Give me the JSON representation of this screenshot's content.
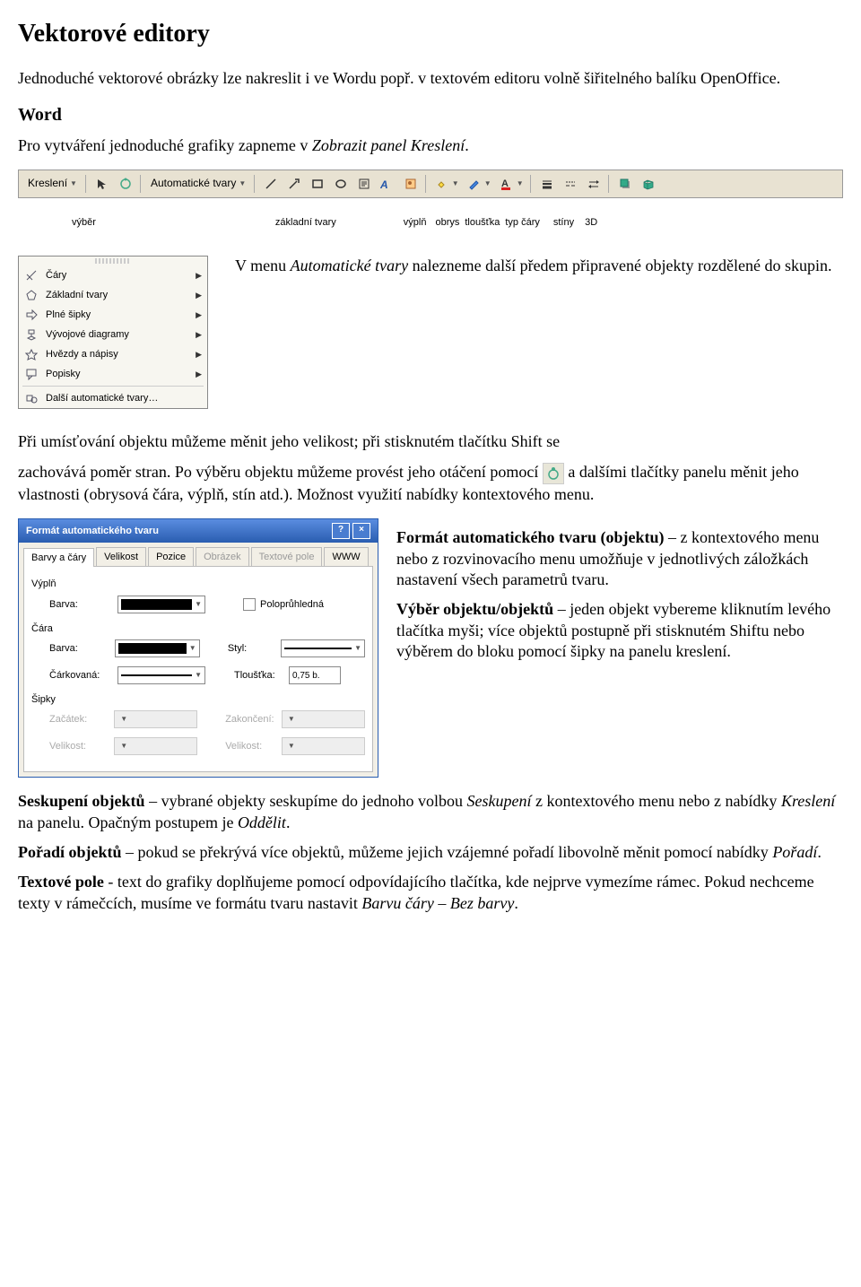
{
  "title": "Vektorové editory",
  "intro": "Jednoduché vektorové obrázky lze nakreslit i ve Wordu popř. v textovém editoru volně šiřitelného balíku OpenOffice.",
  "word_heading": "Word",
  "word_text_pre": "Pro vytváření jednoduché grafiky zapneme v ",
  "word_text_italic": "Zobrazit panel Kreslení",
  "toolbar": {
    "draw": "Kreslení",
    "autoshapes": "Automatické tvary"
  },
  "toolbar_labels": {
    "vyber": "výběr",
    "zakladni_tvary": "základní tvary",
    "vypln": "výplň",
    "obrys": "obrys",
    "tloustka": "tloušťka",
    "typ_cary": "typ čáry",
    "stiny": "stíny",
    "treed": "3D"
  },
  "autoshapes_menu": {
    "items": [
      "Čáry",
      "Základní tvary",
      "Plné šipky",
      "Vývojové diagramy",
      "Hvězdy a nápisy",
      "Popisky"
    ],
    "more": "Další automatické tvary…"
  },
  "autoshapes_text_pre": "V menu ",
  "autoshapes_text_italic": "Automatické tvary",
  "autoshapes_text_post": " nalezneme další předem připravené objekty rozdělené do skupin.",
  "positioning_text": "Při umísťování objektu můžeme měnit jeho velikost; při stisknutém tlačítku Shift se",
  "positioning_text2": "zachovává poměr stran. Po výběru objektu můžeme provést jeho otáčení pomocí ",
  "positioning_text3": " a dalšími tlačítky panelu měnit jeho vlastnosti (obrysová čára, výplň, stín atd.). Možnost využití nabídky kontextového menu.",
  "dialog": {
    "title": "Formát automatického tvaru",
    "tabs": [
      "Barvy a čáry",
      "Velikost",
      "Pozice",
      "Obrázek",
      "Textové pole",
      "WWW"
    ],
    "vypln": "Výplň",
    "barva": "Barva:",
    "polopruhledna": "Poloprůhledná",
    "cara": "Čára",
    "styl": "Styl:",
    "carkovana": "Čárkovaná:",
    "tloustka": "Tloušťka:",
    "tloustka_val": "0,75 b.",
    "sipky": "Šipky",
    "zacatek": "Začátek:",
    "zakonceni": "Zakončení:",
    "velikost": "Velikost:"
  },
  "format_paragraph": {
    "bold": "Formát automatického tvaru (objektu)",
    "rest": " – z kontextového menu nebo z rozvinovacího menu umožňuje v jednotlivých záložkách nastavení všech parametrů tvaru."
  },
  "selection_paragraph": {
    "bold": "Výběr objektu/objektů",
    "rest": " – jeden objekt vybereme kliknutím levého tlačítka myši; více objektů postupně při stisknutém Shiftu nebo výběrem do bloku pomocí šipky na panelu kreslení."
  },
  "grouping": {
    "bold": "Seskupení objektů",
    "t1": " – vybrané objekty seskupíme do jednoho volbou ",
    "i1": "Seskupení",
    "t2": " z kontextového menu nebo z nabídky ",
    "i2": "Kreslení",
    "t3": " na panelu. Opačným postupem je ",
    "i3": "Oddělit"
  },
  "order": {
    "bold": "Pořadí objektů",
    "t1": " – pokud se překrývá více objektů, můžeme jejich vzájemné pořadí libovolně měnit pomocí nabídky ",
    "i1": "Pořadí"
  },
  "textbox": {
    "bold": "Textové pole",
    "t1": " - text do grafiky doplňujeme pomocí odpovídajícího tlačítka, kde nejprve vymezíme rámec. Pokud nechceme texty v rámečcích, musíme ve formátu tvaru nastavit ",
    "i1": "Barvu čáry – Bez barvy"
  }
}
